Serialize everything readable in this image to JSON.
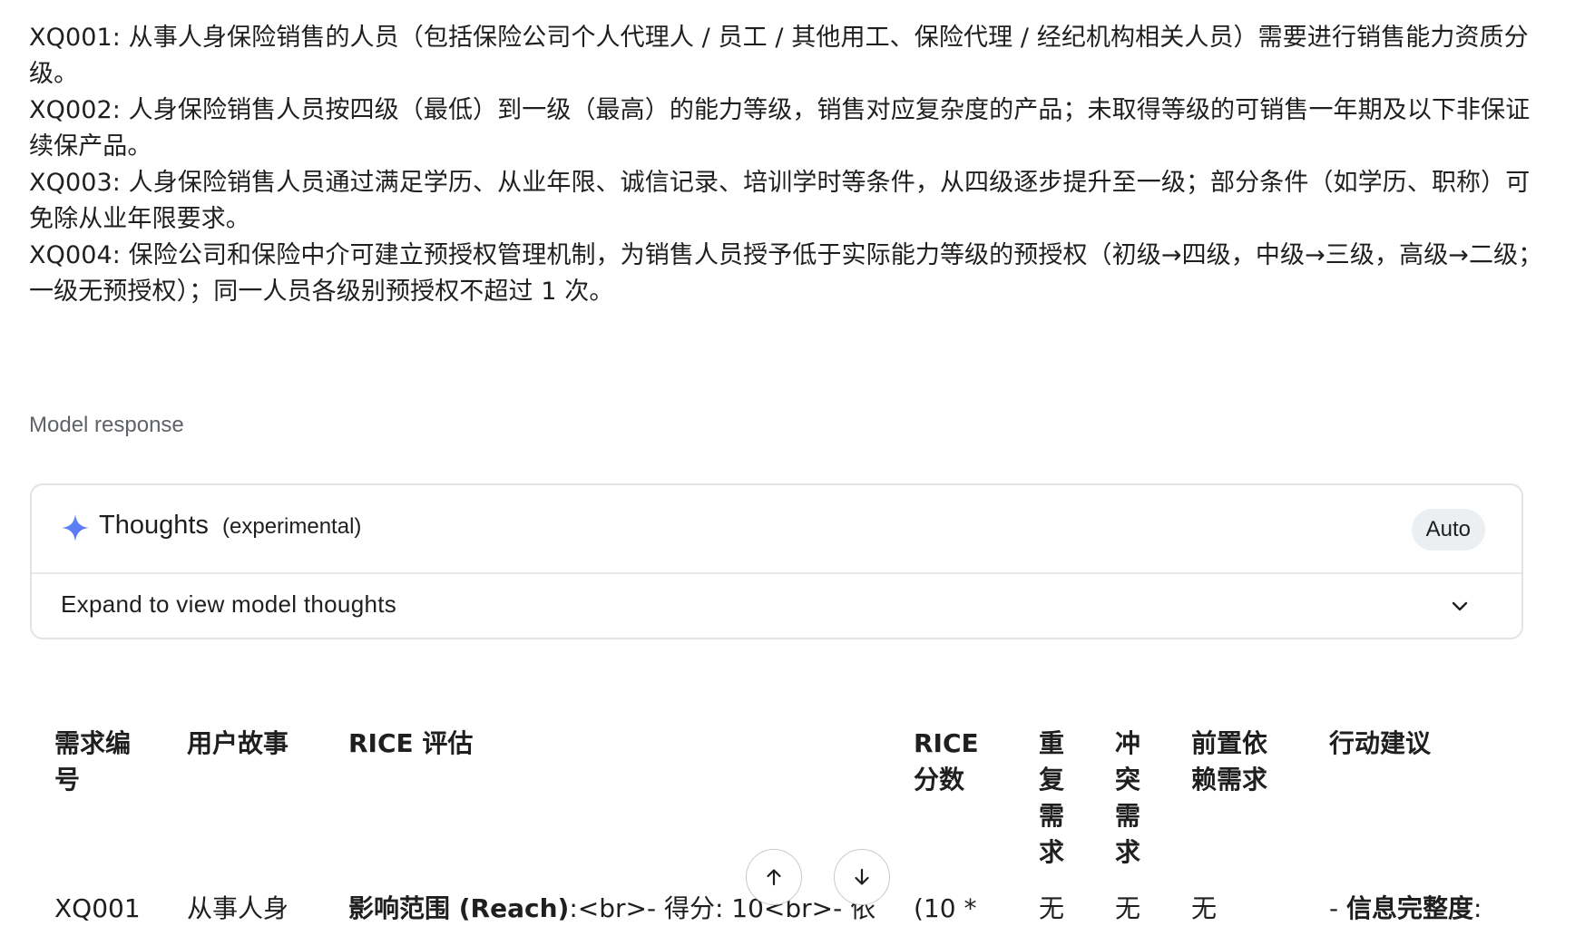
{
  "prompt": {
    "lines": [
      "XQ001: 从事人身保险销售的人员（包括保险公司个人代理人 / 员工 / 其他用工、保险代理 / 经纪机构相关人员）需要进行销售能力资质分级。",
      "XQ002: 人身保险销售人员按四级（最低）到一级（最高）的能力等级，销售对应复杂度的产品；未取得等级的可销售一年期及以下非保证续保产品。",
      "XQ003: 人身保险销售人员通过满足学历、从业年限、诚信记录、培训学时等条件，从四级逐步提升至一级；部分条件（如学历、职称）可免除从业年限要求。",
      "XQ004: 保险公司和保险中介可建立预授权管理机制，为销售人员授予低于实际能力等级的预授权（初级→四级，中级→三级，高级→二级；一级无预授权）；同一人员各级别预授权不超过 1 次。"
    ]
  },
  "section_label": "Model response",
  "thoughts": {
    "title": "Thoughts",
    "subtitle": "(experimental)",
    "badge": "Auto",
    "expand_label": "Expand to view model thoughts",
    "icon": "sparkle-icon",
    "accent_color": "#4285f4"
  },
  "table": {
    "headers": [
      "需求编号",
      "用户故事",
      "RICE 评估",
      "RICE 分数",
      "重复需求",
      "冲突需求",
      "前置依赖需求",
      "行动建议"
    ],
    "rows": [
      {
        "id": "XQ001",
        "story": "从事人身",
        "rice_label": "影响范围 (Reach)",
        "rice_rest": ":<br>- 得分: 10<br>- 依",
        "score": "(10 *",
        "duplicate": "无",
        "conflict": "无",
        "dependency": "无",
        "action_prefix": "- ",
        "action_label": "信息完整度",
        "action_rest": ":"
      }
    ]
  },
  "controls": {
    "scroll_up_icon": "arrow-up-icon",
    "scroll_down_icon": "arrow-down-icon"
  }
}
